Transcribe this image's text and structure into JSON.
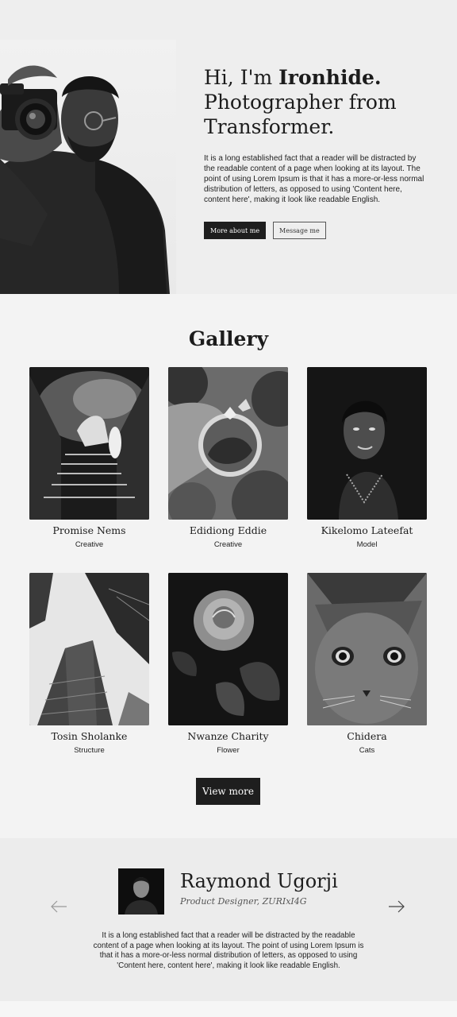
{
  "hero": {
    "greeting": "Hi, I'm ",
    "name": "Ironhide.",
    "title_line2": "Photographer from",
    "title_line3": "Transformer.",
    "description": "It is a long established fact that a reader will be distracted by the readable content of a page when looking at its layout. The point of using Lorem Ipsum is that it has a more-or-less normal distribution of letters, as opposed to using 'Content here, content here', making it look like readable English.",
    "primary_button": "More about me",
    "secondary_button": "Message me"
  },
  "gallery": {
    "title": "Gallery",
    "items": [
      {
        "name": "Promise Nems",
        "category": "Creative"
      },
      {
        "name": "Edidiong Eddie",
        "category": "Creative"
      },
      {
        "name": "Kikelomo Lateefat",
        "category": "Model"
      },
      {
        "name": "Tosin Sholanke",
        "category": "Structure"
      },
      {
        "name": "Nwanze Charity",
        "category": "Flower"
      },
      {
        "name": "Chidera",
        "category": "Cats"
      }
    ],
    "view_more": "View more"
  },
  "testimonial": {
    "name": "Raymond Ugorji",
    "role": "Product Designer, ZURIxI4G",
    "quote": "It is a long established fact that a reader will be distracted by the readable content of a page when looking at its layout. The point of using Lorem Ipsum is that it has a more-or-less normal distribution of letters, as opposed to using 'Content here, content here', making it look like readable English."
  },
  "colors": {
    "dark": "#1e1e1e",
    "background": "#f3f3f3",
    "hero_background": "#eeeeee"
  }
}
